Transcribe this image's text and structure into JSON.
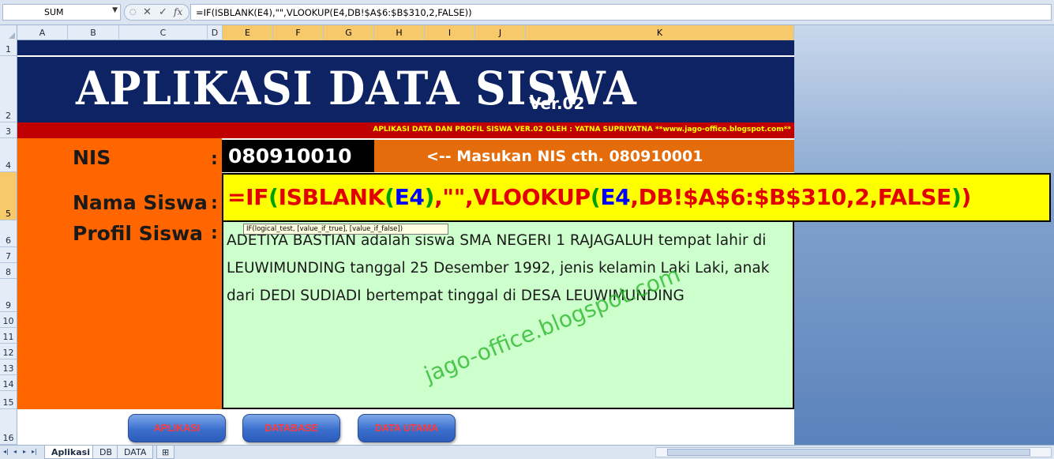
{
  "formula_bar": {
    "name_box": "SUM",
    "cancel_glyph": "✕",
    "enter_glyph": "✓",
    "fx_label": "fx",
    "formula": "=IF(ISBLANK(E4),\"\",VLOOKUP(E4,DB!$A$6:$B$310,2,FALSE))"
  },
  "columns": [
    "A",
    "B",
    "C",
    "D",
    "E",
    "F",
    "G",
    "H",
    "I",
    "J",
    "K"
  ],
  "rows": [
    "1",
    "2",
    "3",
    "4",
    "5",
    "6",
    "7",
    "8",
    "9",
    "10",
    "11",
    "12",
    "13",
    "14",
    "15",
    "16"
  ],
  "header": {
    "title": "APLIKASI DATA SISWA",
    "version": "Ver.02",
    "credit": "APLIKASI DATA DAN PROFIL SISWA VER.02 OLEH : YATNA SUPRIYATNA **www.jago-office.blogspot.com**"
  },
  "form": {
    "nis_label": "NIS",
    "nama_label": "Nama Siswa",
    "profil_label": "Profil Siswa",
    "colon": ":",
    "nis_value": "080910010",
    "hint": "<-- Masukan NIS cth. 080910001",
    "formula_parts": [
      "=IF",
      "(",
      "ISBLANK",
      "(",
      "E4",
      ")",
      ",\"\",VLOOKUP",
      "(",
      "E4",
      ",DB!$A$6:$B$310,2,FALSE",
      ")",
      ")"
    ],
    "tooltip": "IF(logical_test, [value_if_true], [value_if_false])",
    "profile_text": "ADETIYA BASTIAN adalah siswa SMA NEGERI 1 RAJAGALUH tempat lahir di LEUWIMUNDING tanggal 25 Desember 1992, jenis kelamin Laki Laki, anak dari DEDI SUDIADI bertempat tinggal di DESA LEUWIMUNDING"
  },
  "watermark": "jago-office.blogspot.com",
  "buttons": {
    "aplikasi": "APLIKASI",
    "database": "DATABASE",
    "data_utama": "DATA UTAMA"
  },
  "sheet_tabs": [
    "Aplikasi",
    "DB",
    "DATA"
  ]
}
